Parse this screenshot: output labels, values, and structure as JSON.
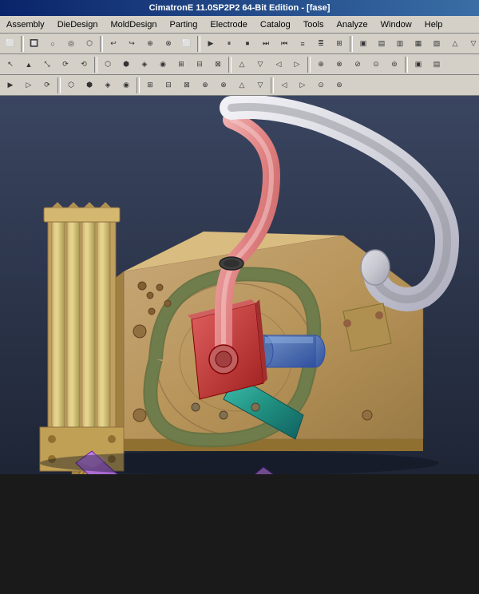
{
  "titlebar": {
    "text": "CimatronE 11.0SP2P2 64-Bit Edition - [fase]"
  },
  "menubar": {
    "items": [
      "Assembly",
      "DieDesign",
      "MoldDesign",
      "Parting",
      "Electrode",
      "Catalog",
      "Tools",
      "Analyze",
      "Window",
      "Help"
    ]
  },
  "toolbar1": {
    "buttons": [
      "⬛",
      "🔲",
      "○",
      "◉",
      "↩",
      "↪",
      "⬜",
      "⬛",
      "□",
      "■",
      "▷",
      "◁",
      "▽",
      "△",
      "⊕",
      "⊗",
      "≡",
      "≣",
      "⊞",
      "⊟",
      "⊠"
    ]
  },
  "toolbar2": {
    "buttons": [
      "↖",
      "↗",
      "⤡",
      "⟳",
      "⟲",
      "⬡",
      "⬢",
      "⊞",
      "⊟",
      "⊠",
      "⊕",
      "⊗",
      "△",
      "▽",
      "◁",
      "▷"
    ]
  },
  "toolbar3": {
    "buttons": [
      "▶",
      "▷",
      "⟳",
      "⟲",
      "⬡",
      "⬢",
      "⊞",
      "⊟",
      "⊠",
      "⊕",
      "⊗"
    ]
  },
  "viewport": {
    "background": "#2d3545"
  },
  "statusbar": {
    "text": ""
  }
}
